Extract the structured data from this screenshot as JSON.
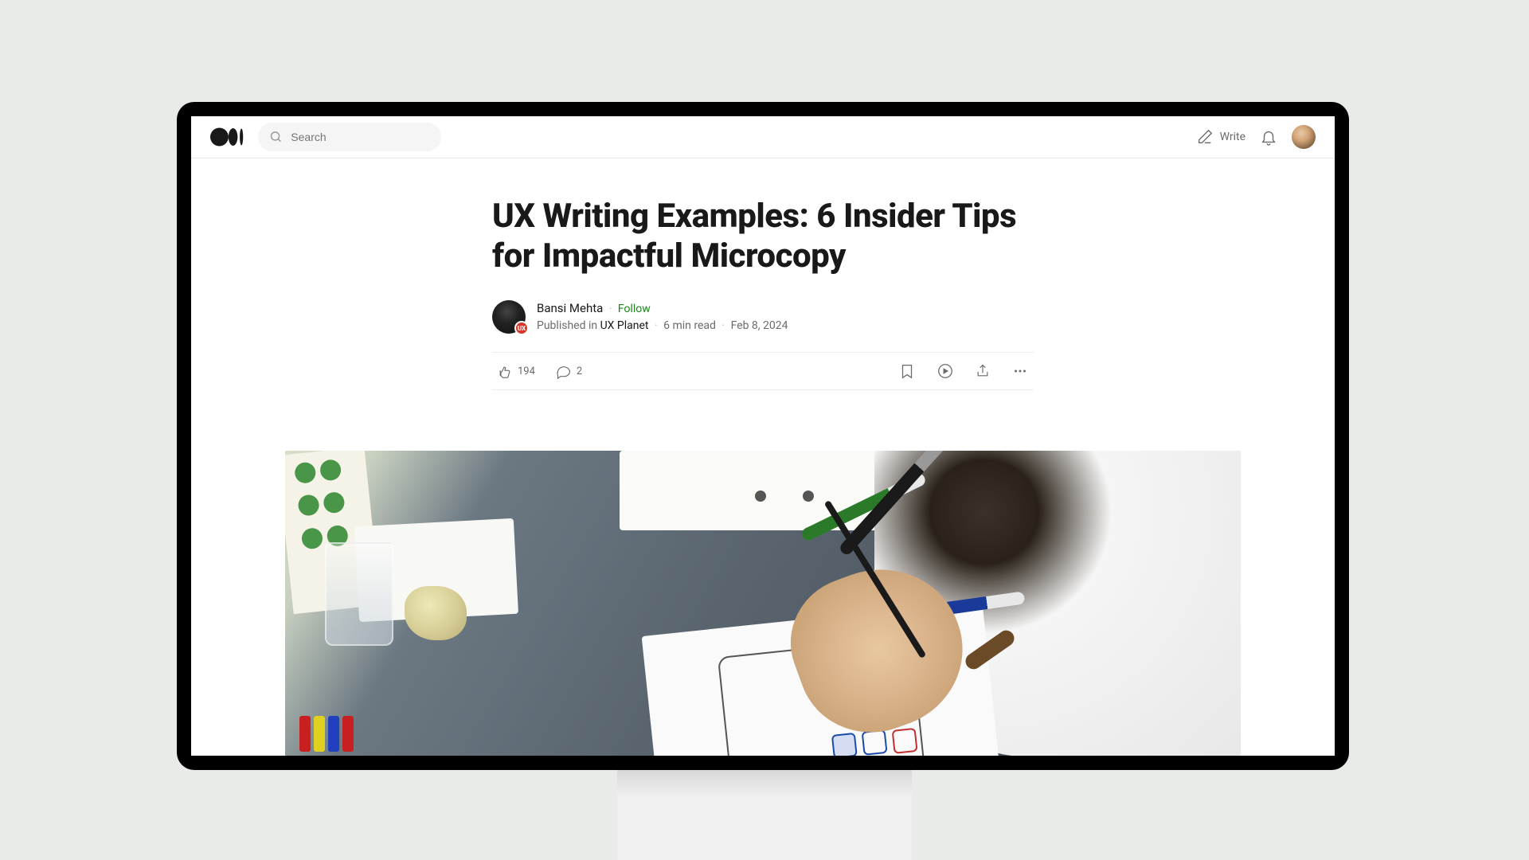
{
  "header": {
    "search_placeholder": "Search",
    "write_label": "Write"
  },
  "article": {
    "title": "UX Writing Examples: 6 Insider Tips for Impactful Microcopy",
    "author_name": "Bansi Mehta",
    "follow_label": "Follow",
    "published_in_label": "Published in",
    "publication_name": "UX Planet",
    "publication_badge": "UX",
    "read_time": "6 min read",
    "publish_date": "Feb 8, 2024",
    "claps": "194",
    "comments": "2"
  }
}
